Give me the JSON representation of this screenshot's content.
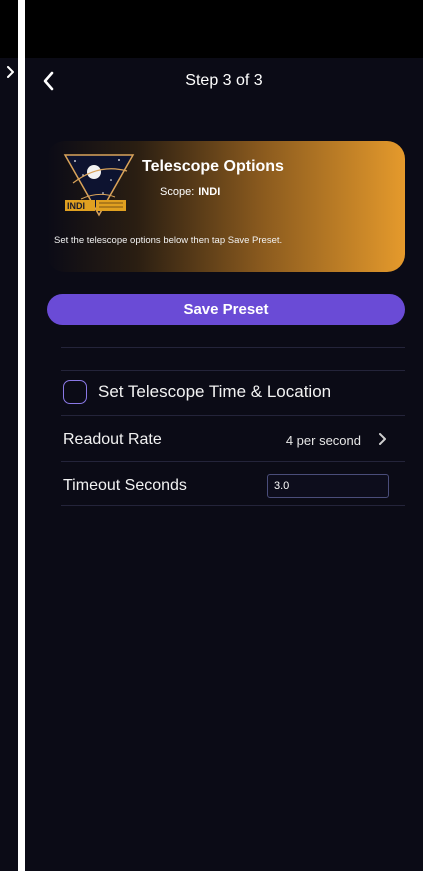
{
  "nav": {
    "title": "Step 3 of 3"
  },
  "header_card": {
    "title": "Telescope Options",
    "scope_label": "Scope:",
    "scope_value": "INDI",
    "description": "Set the telescope options below then tap Save Preset.",
    "logo_text": "INDI"
  },
  "save_button": {
    "label": "Save Preset"
  },
  "options": {
    "set_time_location": {
      "label": "Set Telescope Time & Location",
      "checked": false
    },
    "readout_rate": {
      "label": "Readout Rate",
      "value": "4 per second"
    },
    "timeout_seconds": {
      "label": "Timeout Seconds",
      "value": "3.0"
    }
  },
  "colors": {
    "background": "#0b0b16",
    "accent_purple": "#6a4bd6",
    "card_orange": "#e59a2c",
    "checkbox_border": "#8a78e6"
  },
  "icons": {
    "back": "chevron-left-icon",
    "row_disclosure": "chevron-right-icon",
    "logo": "indi-logo-icon"
  }
}
